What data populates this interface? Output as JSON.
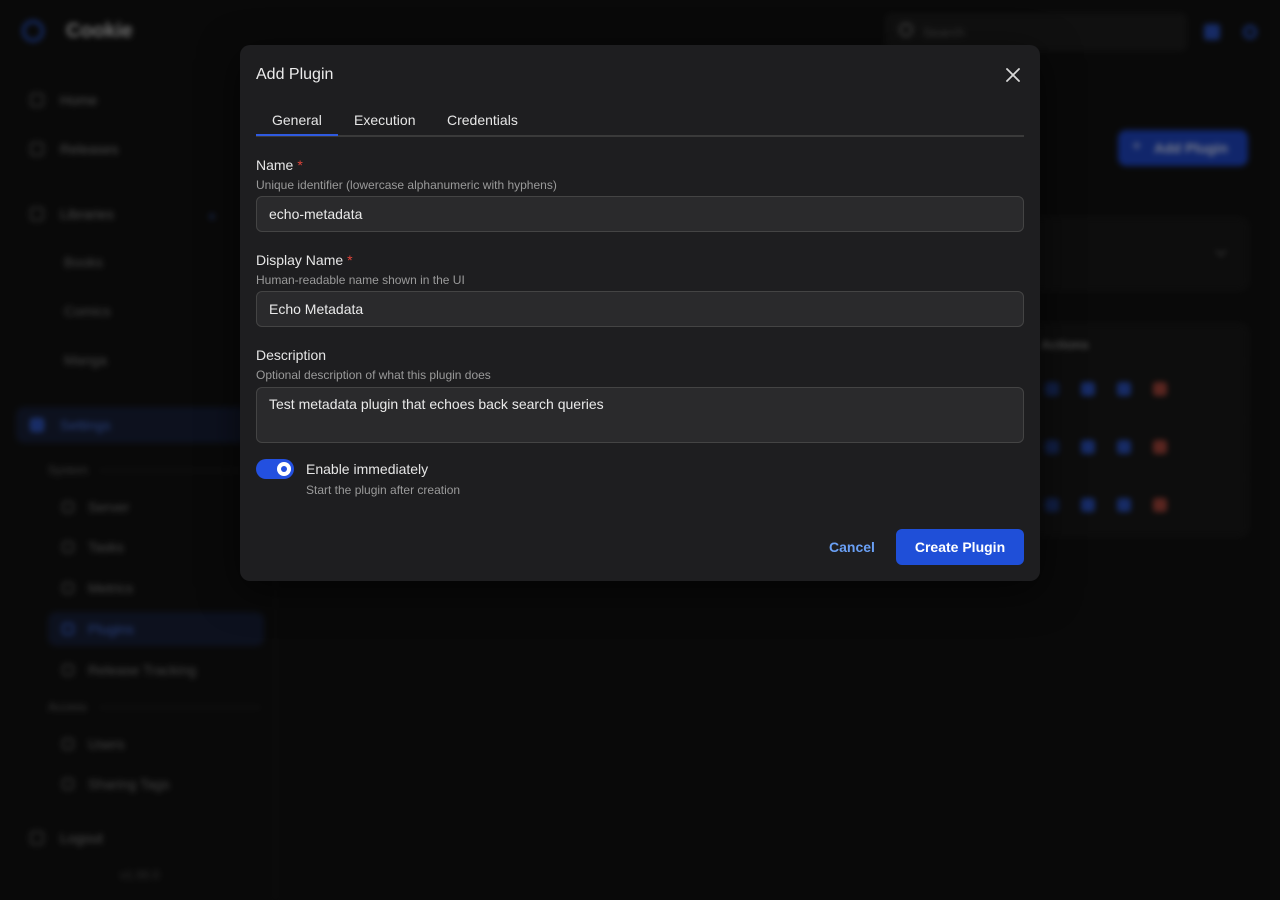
{
  "app": {
    "brand": "Cookie",
    "search_placeholder": "Search",
    "version": "v1.00.0"
  },
  "sidebar": {
    "items": [
      {
        "label": "Home",
        "icon": "home-icon"
      },
      {
        "label": "Releases",
        "icon": "releases-icon"
      },
      {
        "label": "Libraries",
        "icon": "libraries-icon"
      },
      {
        "label": "Settings",
        "icon": "settings-icon"
      },
      {
        "label": "Logout",
        "icon": "logout-icon"
      }
    ],
    "library_subitems": [
      "Books",
      "Comics",
      "Manga"
    ],
    "system_section": "System",
    "system_items": [
      {
        "label": "Server",
        "icon": "server-icon"
      },
      {
        "label": "Tasks",
        "icon": "tasks-icon"
      },
      {
        "label": "Metrics",
        "icon": "metrics-icon"
      },
      {
        "label": "Plugins",
        "icon": "plugins-icon"
      },
      {
        "label": "Release Tracking",
        "icon": "release-tracking-icon"
      }
    ],
    "access_section": "Access",
    "access_items": [
      {
        "label": "Users",
        "icon": "users-icon"
      },
      {
        "label": "Sharing Tags",
        "icon": "sharing-tags-icon"
      }
    ]
  },
  "background": {
    "add_plugin_label": "Add Plugin",
    "table_header": "Actions"
  },
  "modal": {
    "title": "Add Plugin",
    "tabs": [
      "General",
      "Execution",
      "Credentials"
    ],
    "active_tab": "General",
    "fields": {
      "name": {
        "label": "Name",
        "required_mark": "*",
        "help": "Unique identifier (lowercase alphanumeric with hyphens)",
        "value": "echo-metadata"
      },
      "display_name": {
        "label": "Display Name",
        "required_mark": "*",
        "help": "Human-readable name shown in the UI",
        "value": "Echo Metadata"
      },
      "description": {
        "label": "Description",
        "help": "Optional description of what this plugin does",
        "value": "Test metadata plugin that echoes back search queries"
      }
    },
    "toggle": {
      "label": "Enable immediately",
      "help": "Start the plugin after creation",
      "enabled": true
    },
    "buttons": {
      "cancel": "Cancel",
      "create": "Create Plugin"
    }
  },
  "colors": {
    "accent": "#1f4fd8",
    "required": "#e0443a",
    "link": "#6aa0f5",
    "modal_bg": "#1e1e20"
  }
}
